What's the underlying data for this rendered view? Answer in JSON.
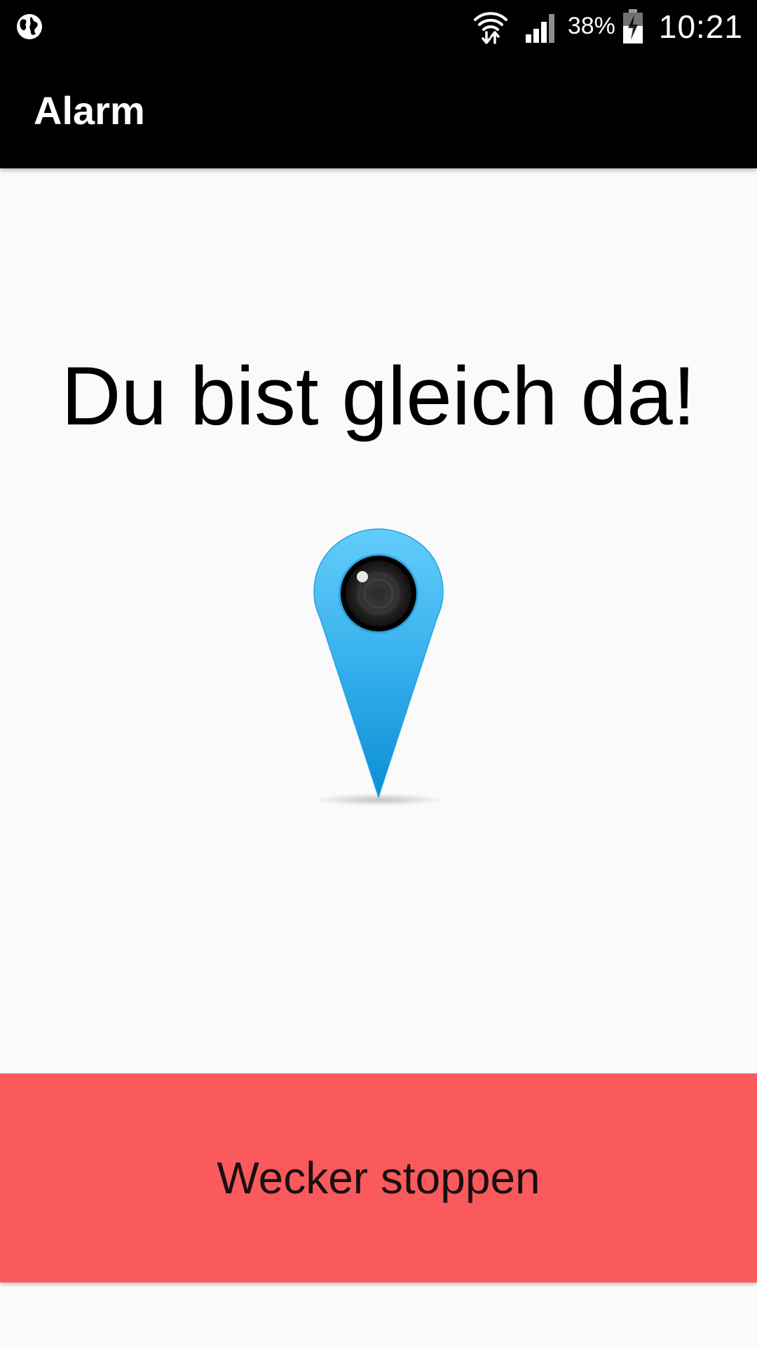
{
  "status_bar": {
    "left_icon": "globe-icon",
    "wifi_icon": "wifi-icon",
    "signal_icon": "cellular-signal-icon",
    "battery_percent": "38%",
    "battery_icon": "battery-charging-icon",
    "time": "10:21"
  },
  "toolbar": {
    "title": "Alarm"
  },
  "main": {
    "headline": "Du bist gleich da!",
    "pin_icon": "map-pin-camera-icon"
  },
  "stop_button": {
    "label": "Wecker stoppen"
  },
  "colors": {
    "status_bar_bg": "#000000",
    "toolbar_bg": "#000000",
    "page_bg": "#fafafa",
    "stop_button_bg": "#fa5a5c",
    "pin_top": "#5ac8fa",
    "pin_bottom": "#0a90d4"
  }
}
